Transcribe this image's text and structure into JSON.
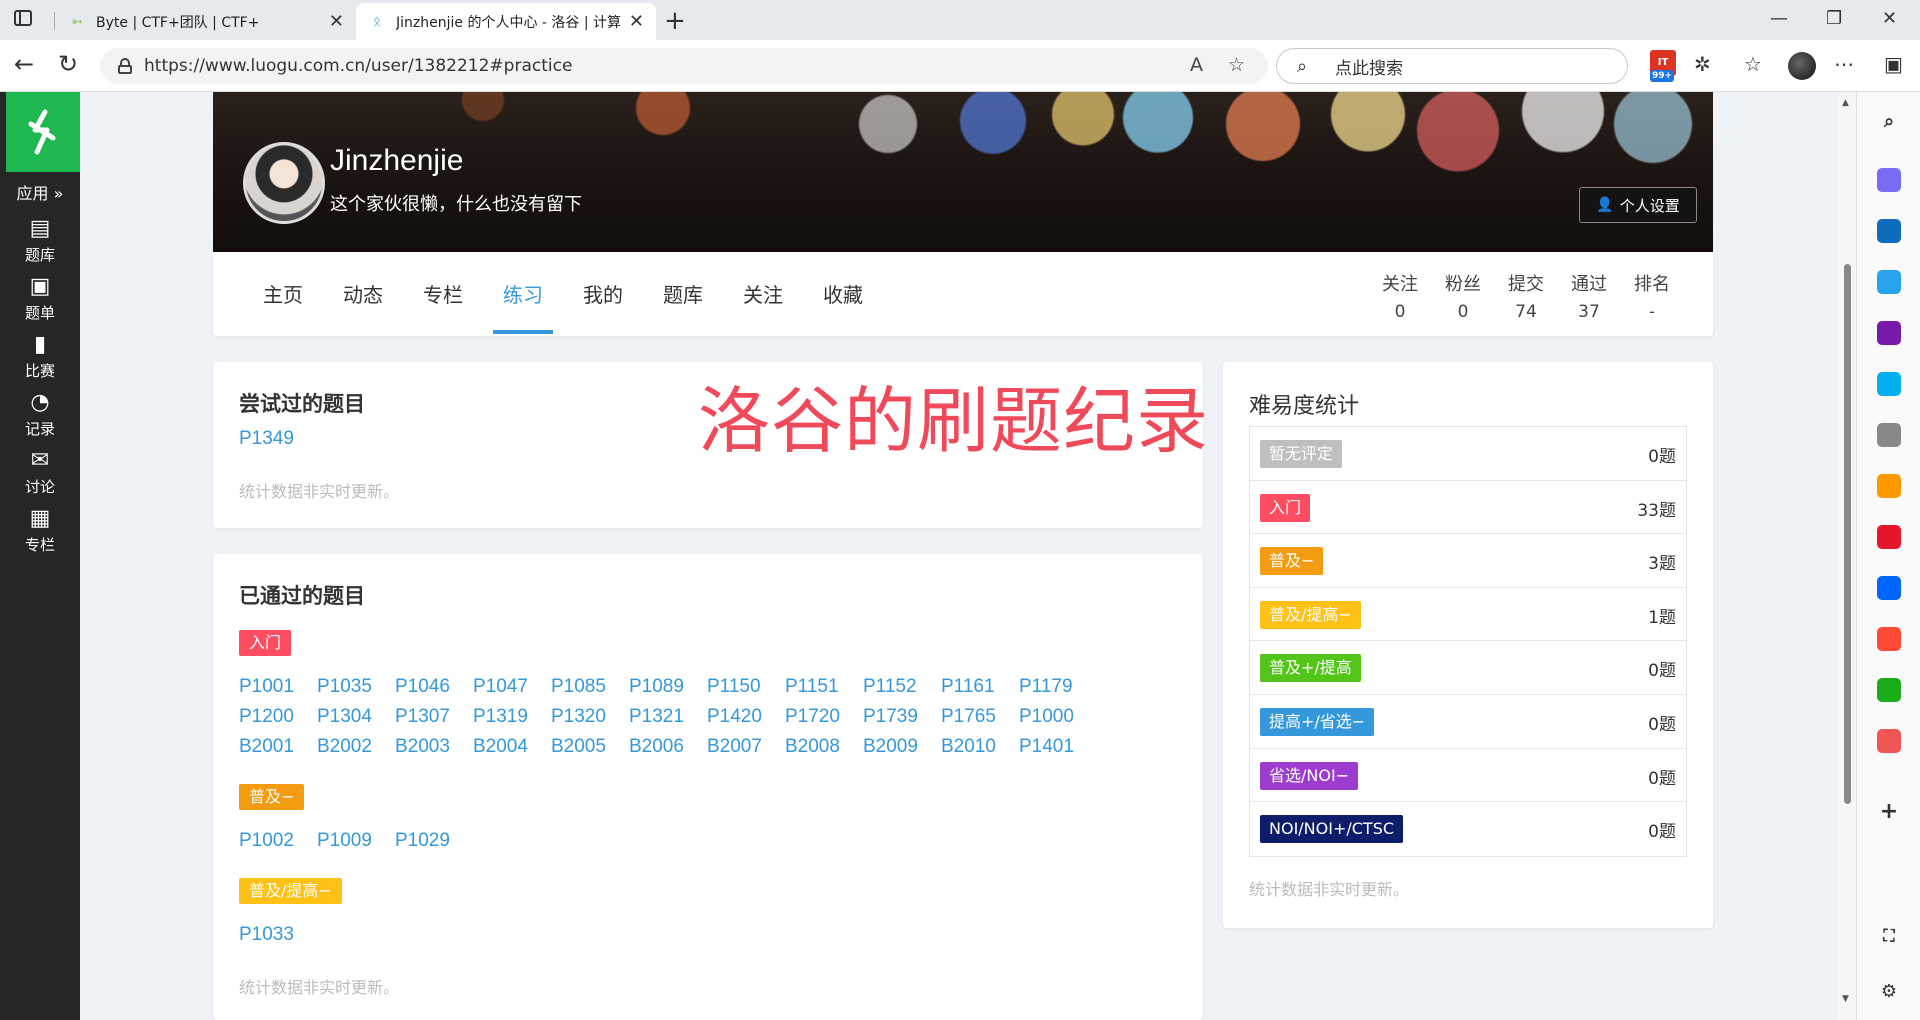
{
  "browser": {
    "tabs": [
      {
        "title": "Byte | CTF+团队 | CTF+",
        "close": "✕"
      },
      {
        "title": "Jinzhenjie 的个人中心 - 洛谷 | 计算机",
        "close": "✕"
      }
    ],
    "new_tab": "+",
    "url": "https://www.luogu.com.cn/user/1382212#practice",
    "search_placeholder": "点此搜索",
    "notif_badge": "99+",
    "notif_brand": "IT"
  },
  "luogu_nav": {
    "apps_label": "应用 »",
    "items": [
      {
        "icon": "▤",
        "label": "题库"
      },
      {
        "icon": "▣",
        "label": "题单"
      },
      {
        "icon": "▮",
        "label": "比赛"
      },
      {
        "icon": "◔",
        "label": "记录"
      },
      {
        "icon": "✉",
        "label": "讨论"
      },
      {
        "icon": "▦",
        "label": "专栏"
      }
    ]
  },
  "profile": {
    "username": "Jinzhenjie",
    "slogan": "这个家伙很懒，什么也没有留下",
    "settings_label": "个人设置"
  },
  "profile_tabs": [
    "主页",
    "动态",
    "专栏",
    "练习",
    "我的",
    "题库",
    "关注",
    "收藏"
  ],
  "active_tab": "练习",
  "stats": [
    {
      "label": "关注",
      "value": "0"
    },
    {
      "label": "粉丝",
      "value": "0"
    },
    {
      "label": "提交",
      "value": "74"
    },
    {
      "label": "通过",
      "value": "37"
    },
    {
      "label": "排名",
      "value": "-"
    }
  ],
  "tried": {
    "title": "尝试过的题目",
    "problems": [
      "P1349"
    ],
    "note": "统计数据非实时更新。"
  },
  "watermark": "洛谷的刷题纪录",
  "passed": {
    "title": "已通过的题目",
    "groups": [
      {
        "level": "入门",
        "color": "#fe4c61",
        "problems": [
          "P1001",
          "P1035",
          "P1046",
          "P1047",
          "P1085",
          "P1089",
          "P1150",
          "P1151",
          "P1152",
          "P1161",
          "P1179",
          "P1200",
          "P1304",
          "P1307",
          "P1319",
          "P1320",
          "P1321",
          "P1420",
          "P1720",
          "P1739",
          "P1765",
          "P1000",
          "B2001",
          "B2002",
          "B2003",
          "B2004",
          "B2005",
          "B2006",
          "B2007",
          "B2008",
          "B2009",
          "B2010",
          "P1401"
        ]
      },
      {
        "level": "普及−",
        "color": "#f39c11",
        "problems": [
          "P1002",
          "P1009",
          "P1029"
        ]
      },
      {
        "level": "普及/提高−",
        "color": "#ffc116",
        "problems": [
          "P1033"
        ]
      }
    ],
    "note": "统计数据非实时更新。"
  },
  "difficulty": {
    "title": "难易度统计",
    "rows": [
      {
        "label": "暂无评定",
        "color": "#bfbfbf",
        "count": "0题"
      },
      {
        "label": "入门",
        "color": "#fe4c61",
        "count": "33题"
      },
      {
        "label": "普及−",
        "color": "#f39c11",
        "count": "3题"
      },
      {
        "label": "普及/提高−",
        "color": "#ffc116",
        "count": "1题"
      },
      {
        "label": "普及+/提高",
        "color": "#52c41a",
        "count": "0题"
      },
      {
        "label": "提高+/省选−",
        "color": "#3498db",
        "count": "0题"
      },
      {
        "label": "省选/NOI−",
        "color": "#9d3dcf",
        "count": "0题"
      },
      {
        "label": "NOI/NOI+/CTSC",
        "color": "#0e1d69",
        "count": "0题"
      }
    ],
    "note": "统计数据非实时更新。"
  },
  "edge_icons": [
    {
      "name": "copilot-icon",
      "color": "#7b6cf6"
    },
    {
      "name": "outlook-icon",
      "color": "#0f6cbd"
    },
    {
      "name": "telegram-icon",
      "color": "#2aa3ef"
    },
    {
      "name": "onenote-icon",
      "color": "#7719aa"
    },
    {
      "name": "skype-icon",
      "color": "#00aff0"
    },
    {
      "name": "eagle-icon",
      "color": "#888"
    },
    {
      "name": "video-icon",
      "color": "#ff9900"
    },
    {
      "name": "weibo-icon",
      "color": "#e6162d"
    },
    {
      "name": "zhihu-icon",
      "color": "#0066ff"
    },
    {
      "name": "app-red-icon",
      "color": "#ff4b33"
    },
    {
      "name": "app-green-icon",
      "color": "#1aad19"
    },
    {
      "name": "app-red2-icon",
      "color": "#f05656"
    }
  ]
}
